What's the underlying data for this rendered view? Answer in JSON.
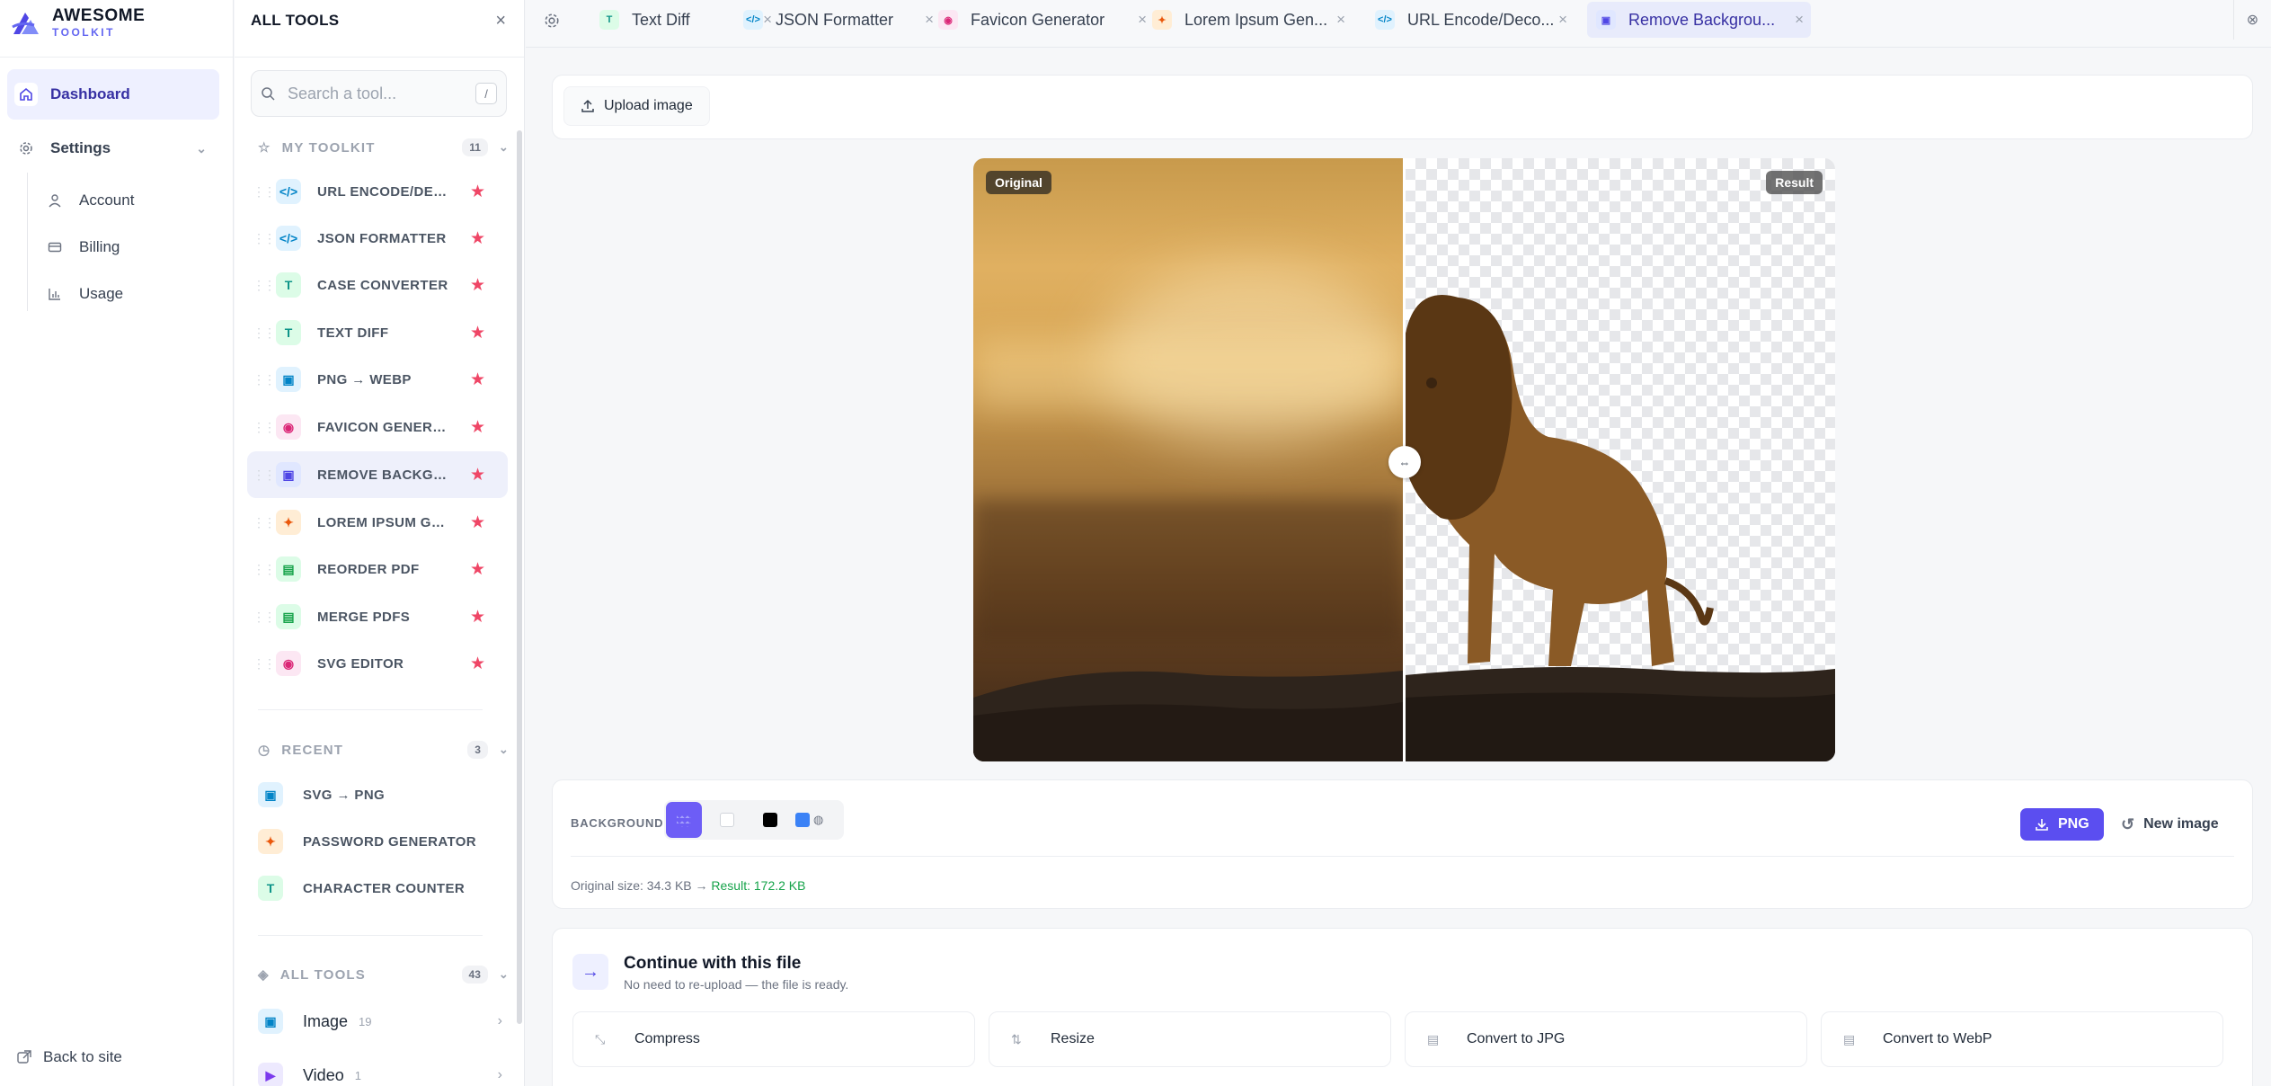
{
  "app": {
    "logo_line1": "AWESOME",
    "logo_line2": "TOOLKIT",
    "accent": "#5b4ef0",
    "star_color": "#ef4666"
  },
  "nav": {
    "dashboard": "Dashboard",
    "settings": "Settings",
    "sub_items": [
      "Account",
      "Billing",
      "Usage"
    ],
    "back": "Back to site"
  },
  "panel": {
    "title": "ALL TOOLS",
    "search_placeholder": "Search a tool...",
    "search_shortcut": "/",
    "my_toolkit": {
      "label": "MY TOOLKIT",
      "count": "11",
      "items": [
        {
          "label": "URL ENCODE/DECODE",
          "icon": "code-icon"
        },
        {
          "label": "JSON FORMATTER",
          "icon": "code-icon"
        },
        {
          "label": "CASE CONVERTER",
          "icon": "text-icon"
        },
        {
          "label": "TEXT DIFF",
          "icon": "text-icon"
        },
        {
          "label": "PNG → WEBP",
          "icon": "image-icon"
        },
        {
          "label": "FAVICON GENERATOR",
          "icon": "palette-icon"
        },
        {
          "label": "REMOVE BACKGROUND",
          "icon": "image-icon"
        },
        {
          "label": "LOREM IPSUM GENERATOR",
          "icon": "wand-icon"
        },
        {
          "label": "REORDER PDF",
          "icon": "document-icon"
        },
        {
          "label": "MERGE PDFS",
          "icon": "document-icon"
        },
        {
          "label": "SVG EDITOR",
          "icon": "palette-icon"
        }
      ]
    },
    "recent": {
      "label": "RECENT",
      "count": "3",
      "items": [
        {
          "label": "SVG → PNG",
          "icon": "image-icon"
        },
        {
          "label": "PASSWORD GENERATOR",
          "icon": "wand-icon"
        },
        {
          "label": "CHARACTER COUNTER",
          "icon": "text-icon"
        }
      ]
    },
    "all_tools": {
      "label": "ALL TOOLS",
      "count": "43",
      "categories": [
        {
          "label": "Image",
          "count": "19",
          "icon": "image-icon"
        },
        {
          "label": "Video",
          "count": "1",
          "icon": "video-icon"
        }
      ]
    }
  },
  "tabs": [
    {
      "label": "Text Diff",
      "icon": "text-icon"
    },
    {
      "label": "JSON Formatter",
      "icon": "code-icon"
    },
    {
      "label": "Favicon Generator",
      "icon": "palette-icon"
    },
    {
      "label": "Lorem Ipsum Gen...",
      "icon": "wand-icon"
    },
    {
      "label": "URL Encode/Deco...",
      "icon": "code-icon"
    },
    {
      "label": "Remove Backgrou...",
      "icon": "image-icon",
      "active": true
    }
  ],
  "main": {
    "upload_label": "Upload image",
    "badge_original": "Original",
    "badge_result": "Result",
    "background_label": "BACKGROUND",
    "swatches": [
      "transparent",
      "#ffffff",
      "#000000",
      "#3b82f6"
    ],
    "download_label": "PNG",
    "new_image_label": "New image",
    "original_size": "Original size: 34.3 KB →",
    "result_size": "Result: 172.2 KB",
    "continue_title": "Continue with this file",
    "continue_sub": "No need to re-upload — the file is ready.",
    "actions": [
      "Compress",
      "Resize",
      "Convert to JPG",
      "Convert to WebP"
    ]
  }
}
